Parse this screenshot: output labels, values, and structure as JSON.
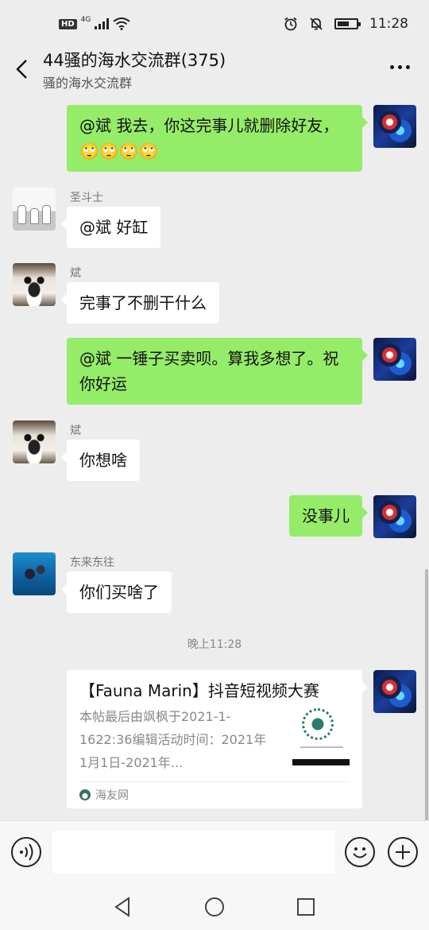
{
  "status_bar": {
    "hd_label": "HD",
    "network_label": "4G",
    "time": "11:28"
  },
  "header": {
    "title": "44骚的海水交流群(375)",
    "subtitle": "骚的海水交流群"
  },
  "messages": [
    {
      "side": "out",
      "text": "@斌  我去，你这完事儿就删除好友，🙄🙄🙄🙄"
    },
    {
      "side": "in",
      "sender": "圣斗士",
      "text": "@斌  好缸"
    },
    {
      "side": "in",
      "sender": "斌",
      "text": "完事了不删干什么"
    },
    {
      "side": "out",
      "text": "@斌  一锤子买卖呗。算我多想了。祝你好运"
    },
    {
      "side": "in",
      "sender": "斌",
      "text": "你想啥"
    },
    {
      "side": "out",
      "text": "没事儿"
    },
    {
      "side": "in",
      "sender": "东来东往",
      "text": "你们买啥了"
    }
  ],
  "timestamp": "晚上11:28",
  "link_card": {
    "title": "【Fauna Marin】抖音短视频大赛",
    "description": "本帖最后由飒枫于2021-1-1622:36编辑活动时间：2021年1月1日-2021年...",
    "source": "海友网"
  },
  "colors": {
    "outgoing_bubble": "#95ec69",
    "incoming_bubble": "#ffffff",
    "background": "#ededed"
  }
}
